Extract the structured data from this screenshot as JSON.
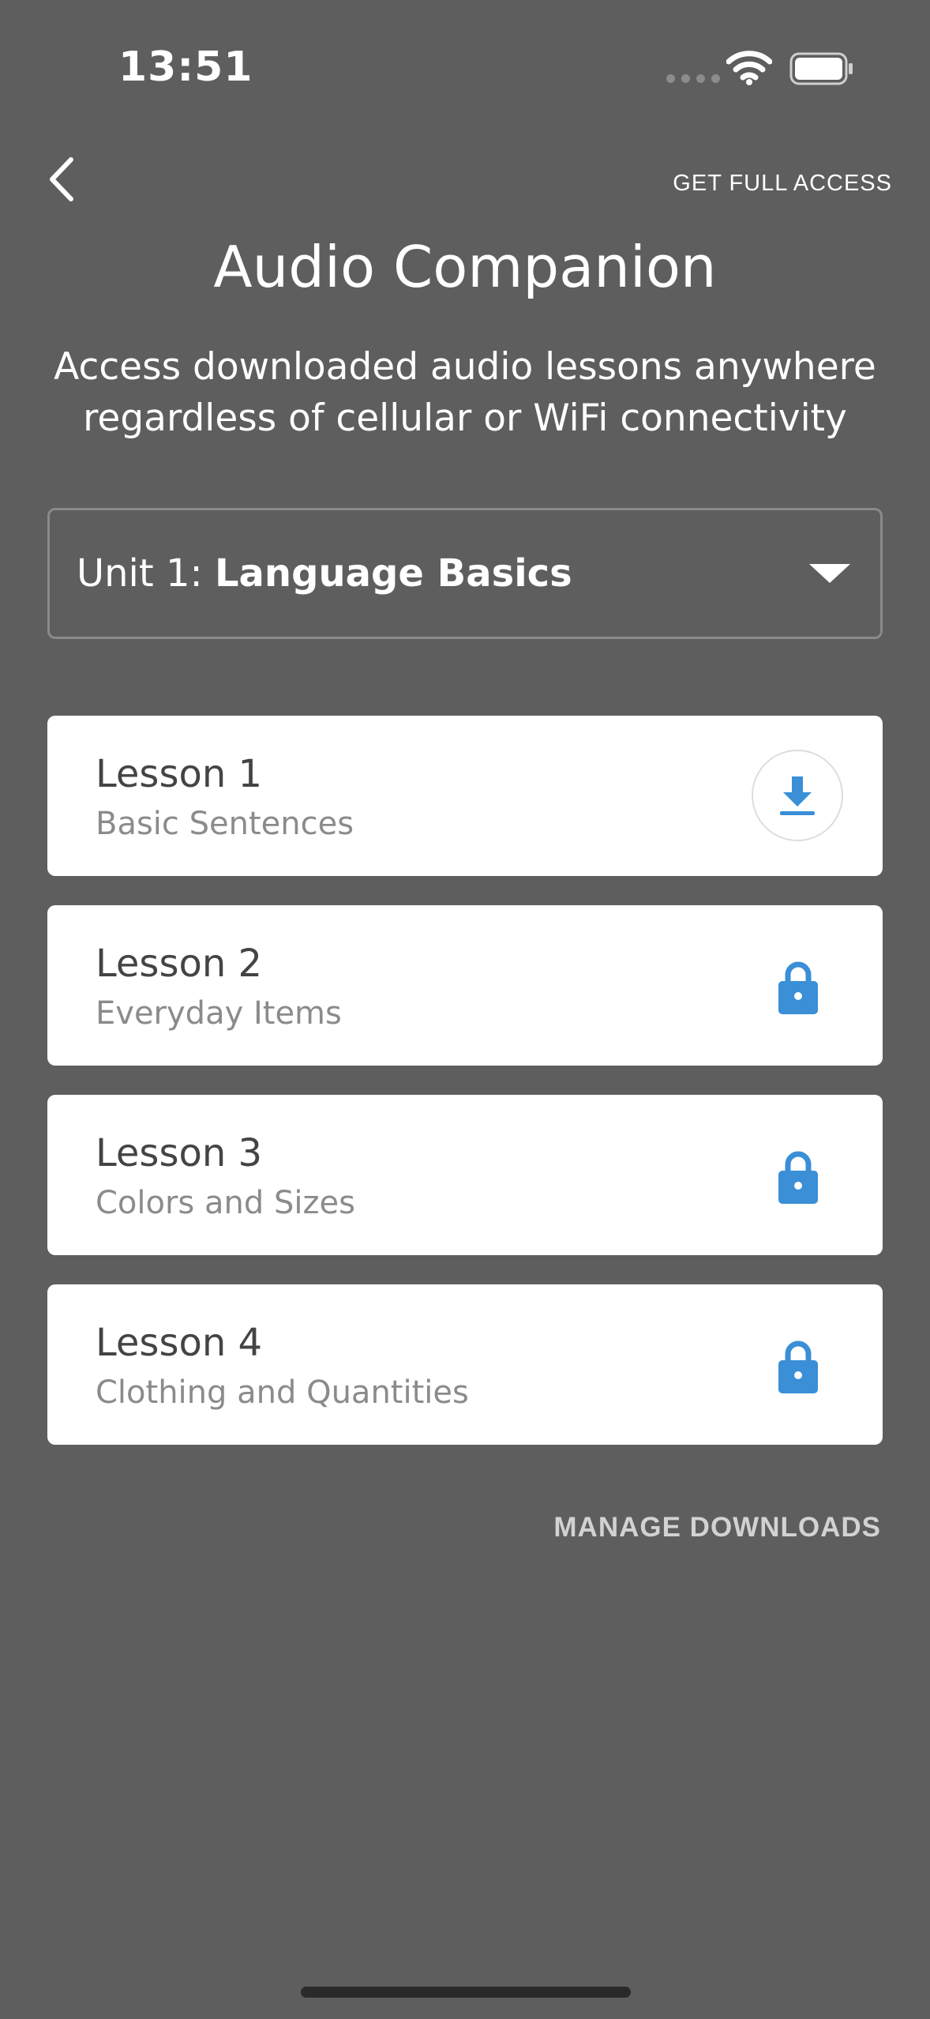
{
  "status_bar": {
    "time": "13:51",
    "icons": [
      "cellular-signal-icon",
      "wifi-icon",
      "battery-icon"
    ]
  },
  "nav": {
    "back_icon": "chevron-left-icon",
    "full_access_label": "GET FULL ACCESS"
  },
  "header": {
    "title": "Audio Companion",
    "subtitle": "Access downloaded audio lessons anywhere regardless of cellular or WiFi connectivity"
  },
  "unit_select": {
    "prefix": "Unit 1:",
    "name": "Language Basics",
    "icon": "caret-down-icon"
  },
  "lessons": [
    {
      "title": "Lesson 1",
      "subtitle": "Basic Sentences",
      "state": "download",
      "icon": "download-icon"
    },
    {
      "title": "Lesson 2",
      "subtitle": "Everyday Items",
      "state": "locked",
      "icon": "lock-icon"
    },
    {
      "title": "Lesson 3",
      "subtitle": "Colors and Sizes",
      "state": "locked",
      "icon": "lock-icon"
    },
    {
      "title": "Lesson 4",
      "subtitle": "Clothing and Quantities",
      "state": "locked",
      "icon": "lock-icon"
    }
  ],
  "footer": {
    "manage_label": "MANAGE DOWNLOADS"
  },
  "colors": {
    "background": "#5e5e5e",
    "card": "#ffffff",
    "accent": "#3a8fd6",
    "title_text": "#444444",
    "subtitle_text": "#8b8b8b"
  }
}
